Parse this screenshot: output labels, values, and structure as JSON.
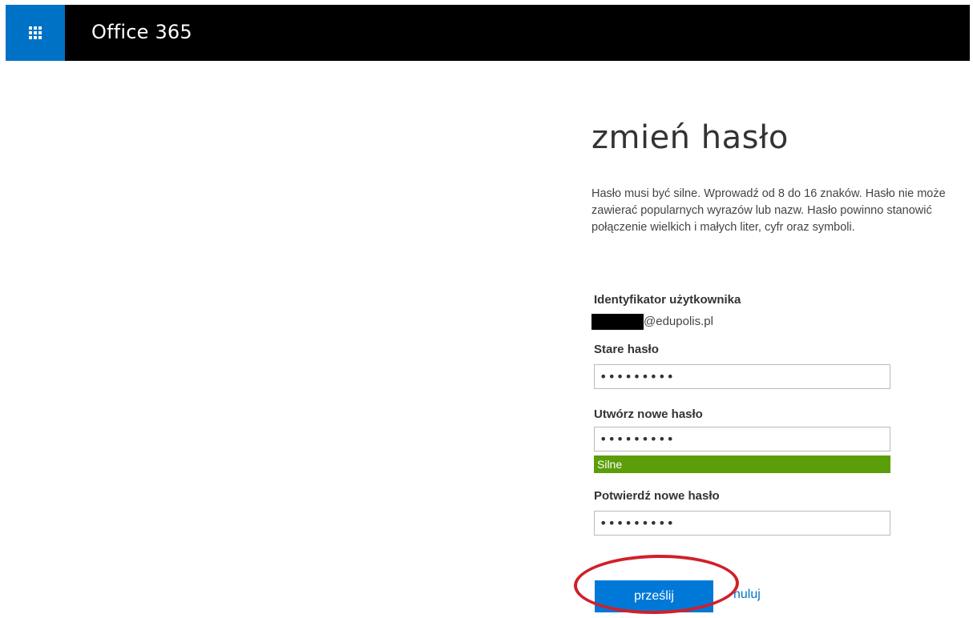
{
  "suitebar": {
    "app_title": "Office 365",
    "waffle_icon": "app-launcher-icon",
    "background": "#000000",
    "waffle_color": "#0072c6"
  },
  "form": {
    "heading": "zmień hasło",
    "description": "Hasło musi być silne. Wprowadź od 8 do 16 znaków. Hasło nie może zawierać popularnych wyrazów lub nazw. Hasło powinno stanowić połączenie wielkich i małych liter, cyfr oraz symboli.",
    "user_id_label": "Identyfikator użytkownika",
    "user_id_domain": "@edupolis.pl",
    "old_password_label": "Stare hasło",
    "old_password_value": "•••••••••",
    "new_password_label": "Utwórz nowe hasło",
    "new_password_value": "•••••••••",
    "strength_label": "Silne",
    "strength_color": "#5c9d0a",
    "confirm_password_label": "Potwierdź nowe hasło",
    "confirm_password_value": "•••••••••",
    "submit_label": "prześlij",
    "cancel_label": "nuluj",
    "accent_color": "#0078d7",
    "annotation_color": "#d0202a"
  }
}
